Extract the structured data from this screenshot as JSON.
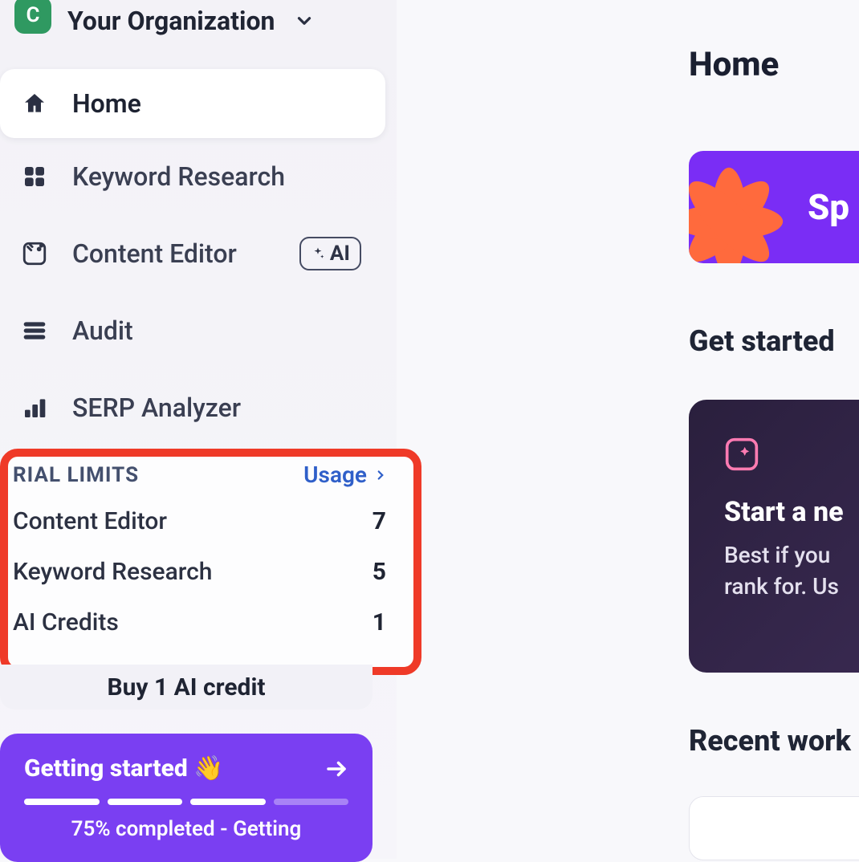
{
  "org": {
    "initial": "C",
    "name": "Your Organization"
  },
  "nav": {
    "home": "Home",
    "keyword_research": "Keyword Research",
    "content_editor": "Content Editor",
    "ai_badge": "AI",
    "audit": "Audit",
    "serp_analyzer": "SERP Analyzer"
  },
  "limits": {
    "title": "RIAL LIMITS",
    "usage_link": "Usage",
    "rows": [
      {
        "label": "Content Editor",
        "value": "7"
      },
      {
        "label": "Keyword Research",
        "value": "5"
      },
      {
        "label": "AI Credits",
        "value": "1"
      }
    ]
  },
  "buy_button": "Buy 1 AI credit",
  "getting_started": {
    "title": "Getting started 👋",
    "progress_text": "75% completed - Getting",
    "segments_done": 3,
    "segments_total": 4
  },
  "main": {
    "page_title": "Home",
    "promo_text": "Sp",
    "get_started_heading": "Get started",
    "start_card": {
      "title": "Start a ne",
      "desc_line1": "Best if you",
      "desc_line2": "rank for. Us"
    },
    "recent_heading": "Recent work"
  }
}
